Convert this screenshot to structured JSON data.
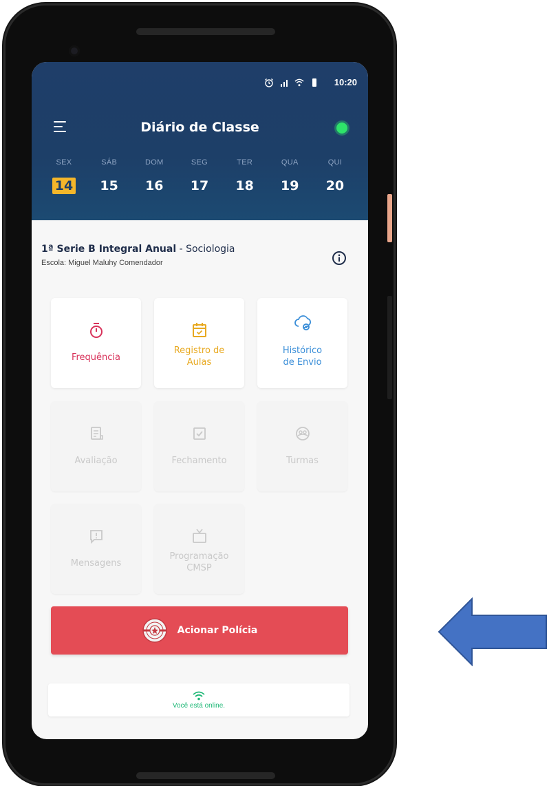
{
  "status_bar": {
    "time": "10:20"
  },
  "app": {
    "title": "Diário de Classe",
    "online_indicator_color": "#2ee36a"
  },
  "week": {
    "days": [
      {
        "name": "SEX",
        "number": "14",
        "selected": true
      },
      {
        "name": "SÁB",
        "number": "15"
      },
      {
        "name": "DOM",
        "number": "16"
      },
      {
        "name": "SEG",
        "number": "17"
      },
      {
        "name": "TER",
        "number": "18"
      },
      {
        "name": "QUA",
        "number": "19"
      },
      {
        "name": "QUI",
        "number": "20"
      }
    ]
  },
  "class_info": {
    "class_name": "1ª Serie B Integral Anual",
    "separator": " - ",
    "subject": "Sociologia",
    "school": "Escola: Miguel Maluhy Comendador"
  },
  "menu": {
    "tiles": [
      {
        "label": "Frequência",
        "icon": "stopwatch-icon",
        "color": "#d8325a",
        "enabled": true
      },
      {
        "label": "Registro de Aulas",
        "icon": "calendar-check-icon",
        "color": "#e8a920",
        "enabled": true
      },
      {
        "label": "Histórico de Envio",
        "icon": "cloud-sync-icon",
        "color": "#3a8ed8",
        "enabled": true
      },
      {
        "label": "Avaliação",
        "icon": "document-icon",
        "enabled": false
      },
      {
        "label": "Fechamento",
        "icon": "checkbox-icon",
        "enabled": false
      },
      {
        "label": "Turmas",
        "icon": "group-icon",
        "enabled": false
      },
      {
        "label": "Mensagens",
        "icon": "message-icon",
        "enabled": false
      },
      {
        "label": "Programação CMSP",
        "icon": "tv-icon",
        "enabled": false
      }
    ]
  },
  "police_button": {
    "label": "Acionar Polícia",
    "color": "#e44c55",
    "icon": "police-badge-icon"
  },
  "connection": {
    "label": "Você está online.",
    "color": "#1fb877",
    "icon": "wifi-icon"
  },
  "annotation": {
    "arrow_color": "#4472c4"
  }
}
